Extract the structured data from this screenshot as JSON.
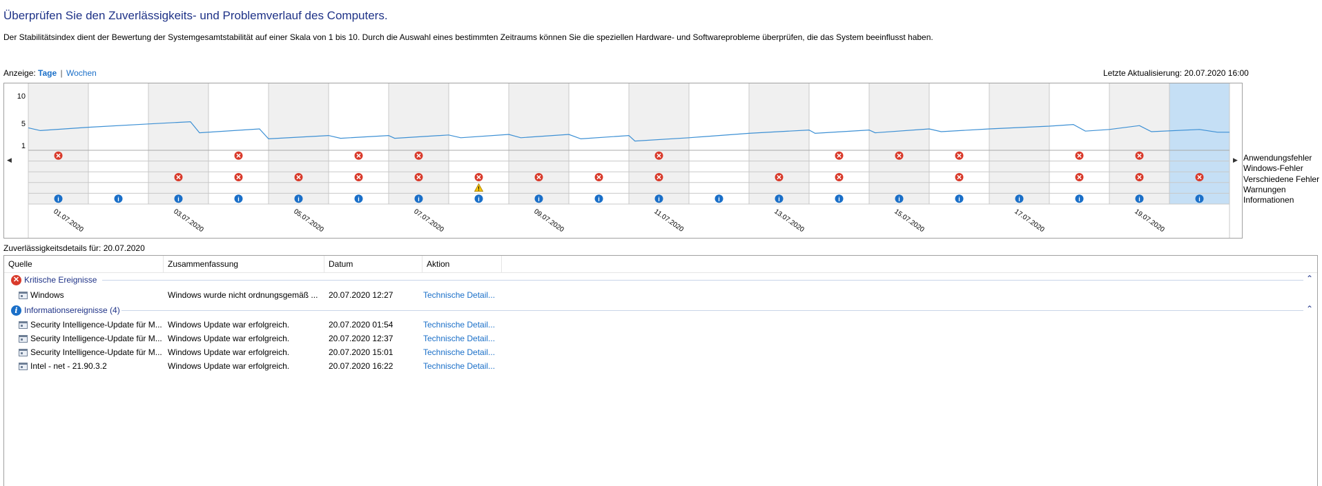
{
  "page": {
    "title": "Überprüfen Sie den Zuverlässigkeits- und Problemverlauf des Computers.",
    "description": "Der Stabilitätsindex dient der Bewertung der Systemgesamtstabilität auf einer Skala von 1 bis 10. Durch die Auswahl eines bestimmten Zeitraums können Sie die speziellen Hardware- und Softwareprobleme überprüfen, die das System beeinflusst haben."
  },
  "view": {
    "label": "Anzeige:",
    "days": "Tage",
    "separator": "|",
    "weeks": "Wochen",
    "selected": "Tage"
  },
  "last_update": "Letzte Aktualisierung: 20.07.2020 16:00",
  "chart_data": {
    "type": "line",
    "y_ticks": [
      "10",
      "5",
      "1"
    ],
    "ylim": [
      1,
      10
    ],
    "dates": [
      "01.07.2020",
      "02.07.2020",
      "03.07.2020",
      "04.07.2020",
      "05.07.2020",
      "06.07.2020",
      "07.07.2020",
      "08.07.2020",
      "09.07.2020",
      "10.07.2020",
      "11.07.2020",
      "12.07.2020",
      "13.07.2020",
      "14.07.2020",
      "15.07.2020",
      "16.07.2020",
      "17.07.2020",
      "18.07.2020",
      "19.07.2020",
      "20.07.2020"
    ],
    "x_tick_labels": [
      "01.07.2020",
      "03.07.2020",
      "05.07.2020",
      "07.07.2020",
      "09.07.2020",
      "11.07.2020",
      "13.07.2020",
      "15.07.2020",
      "17.07.2020",
      "19.07.2020"
    ],
    "selected_date": "20.07.2020",
    "stability_index": [
      [
        0.0,
        4.2
      ],
      [
        0.2,
        3.7
      ],
      [
        1.0,
        4.3
      ],
      [
        2.0,
        4.9
      ],
      [
        2.7,
        5.3
      ],
      [
        2.85,
        3.3
      ],
      [
        3.85,
        4.0
      ],
      [
        4.0,
        2.2
      ],
      [
        5.0,
        2.8
      ],
      [
        5.2,
        2.3
      ],
      [
        6.0,
        2.8
      ],
      [
        6.1,
        2.3
      ],
      [
        7.0,
        2.9
      ],
      [
        7.2,
        2.4
      ],
      [
        8.0,
        3.0
      ],
      [
        8.2,
        2.4
      ],
      [
        9.0,
        3.0
      ],
      [
        9.2,
        2.2
      ],
      [
        10.0,
        2.8
      ],
      [
        10.1,
        1.8
      ],
      [
        11.0,
        2.4
      ],
      [
        12.0,
        3.2
      ],
      [
        13.0,
        3.8
      ],
      [
        13.1,
        3.2
      ],
      [
        14.0,
        3.8
      ],
      [
        14.1,
        3.3
      ],
      [
        15.0,
        4.0
      ],
      [
        15.2,
        3.5
      ],
      [
        16.0,
        4.0
      ],
      [
        17.0,
        4.5
      ],
      [
        17.4,
        4.8
      ],
      [
        17.6,
        3.6
      ],
      [
        18.0,
        3.9
      ],
      [
        18.5,
        4.6
      ],
      [
        18.7,
        3.5
      ],
      [
        19.5,
        3.9
      ],
      [
        19.8,
        3.4
      ],
      [
        20.0,
        3.4
      ]
    ],
    "categories": [
      "Anwendungsfehler",
      "Windows-Fehler",
      "Verschiedene Fehler",
      "Warnungen",
      "Informationen"
    ],
    "events": {
      "Anwendungsfehler": [
        "01.07.2020",
        "04.07.2020",
        "06.07.2020",
        "07.07.2020",
        "11.07.2020",
        "14.07.2020",
        "15.07.2020",
        "16.07.2020",
        "18.07.2020",
        "19.07.2020"
      ],
      "Windows-Fehler": [],
      "Verschiedene Fehler": [
        "03.07.2020",
        "04.07.2020",
        "05.07.2020",
        "06.07.2020",
        "07.07.2020",
        "08.07.2020",
        "09.07.2020",
        "10.07.2020",
        "11.07.2020",
        "13.07.2020",
        "14.07.2020",
        "16.07.2020",
        "18.07.2020",
        "19.07.2020",
        "20.07.2020"
      ],
      "Warnungen": [
        "08.07.2020"
      ],
      "Informationen": [
        "01.07.2020",
        "02.07.2020",
        "03.07.2020",
        "04.07.2020",
        "05.07.2020",
        "06.07.2020",
        "07.07.2020",
        "08.07.2020",
        "09.07.2020",
        "10.07.2020",
        "11.07.2020",
        "12.07.2020",
        "13.07.2020",
        "14.07.2020",
        "15.07.2020",
        "16.07.2020",
        "17.07.2020",
        "18.07.2020",
        "19.07.2020",
        "20.07.2020"
      ]
    },
    "colors": {
      "line": "#3b8fd4",
      "shaded_day": "#f0f0f0",
      "selected_day": "#c5dff5",
      "error": "#d93a2b",
      "info": "#1a6fc8",
      "warning": "#f4c20d"
    }
  },
  "details": {
    "label": "Zuverlässigkeitsdetails für: 20.07.2020",
    "columns": [
      "Quelle",
      "Zusammenfassung",
      "Datum",
      "Aktion"
    ],
    "groups": [
      {
        "title": "Kritische Ereignisse",
        "icon": "error-icon",
        "rows": [
          {
            "source": "Windows",
            "summary": "Windows wurde nicht ordnungsgemäß ...",
            "date": "20.07.2020 12:27",
            "action": "Technische Detail..."
          }
        ]
      },
      {
        "title": "Informationsereignisse (4)",
        "icon": "info-icon",
        "rows": [
          {
            "source": "Security Intelligence-Update für M...",
            "summary": "Windows Update war erfolgreich.",
            "date": "20.07.2020 01:54",
            "action": "Technische Detail..."
          },
          {
            "source": "Security Intelligence-Update für M...",
            "summary": "Windows Update war erfolgreich.",
            "date": "20.07.2020 12:37",
            "action": "Technische Detail..."
          },
          {
            "source": "Security Intelligence-Update für M...",
            "summary": "Windows Update war erfolgreich.",
            "date": "20.07.2020 15:01",
            "action": "Technische Detail..."
          },
          {
            "source": "Intel - net - 21.90.3.2",
            "summary": "Windows Update war erfolgreich.",
            "date": "20.07.2020 16:22",
            "action": "Technische Detail..."
          }
        ]
      }
    ]
  }
}
